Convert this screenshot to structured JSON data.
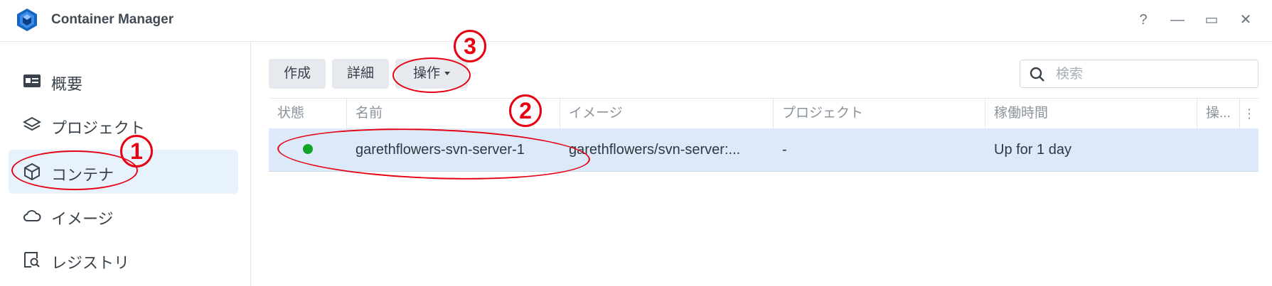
{
  "window": {
    "title": "Container Manager",
    "controls": {
      "help": "?",
      "minimize": "—",
      "maximize": "▭",
      "close": "✕"
    }
  },
  "sidebar": {
    "items": [
      {
        "label": "概要",
        "icon": "overview-card-icon"
      },
      {
        "label": "プロジェクト",
        "icon": "layers-icon"
      },
      {
        "label": "コンテナ",
        "icon": "cube-icon",
        "active": true
      },
      {
        "label": "イメージ",
        "icon": "cloud-icon"
      },
      {
        "label": "レジストリ",
        "icon": "registry-search-icon"
      }
    ]
  },
  "toolbar": {
    "create_label": "作成",
    "details_label": "詳細",
    "action_label": "操作"
  },
  "search": {
    "placeholder": "検索",
    "value": ""
  },
  "table": {
    "columns": [
      "状態",
      "名前",
      "イメージ",
      "プロジェクト",
      "稼働時間",
      "操..."
    ],
    "rows": [
      {
        "status": "running",
        "name": "garethflowers-svn-server-1",
        "image": "garethflowers/svn-server:...",
        "project": "-",
        "uptime": "Up for 1 day"
      }
    ]
  },
  "annotations": {
    "step1": "1",
    "step2": "2",
    "step3": "3"
  },
  "colors": {
    "accent": "#1e6bd6",
    "row_selected": "#dce9f8",
    "status_running": "#10a528",
    "annotation_red": "#e60012"
  }
}
